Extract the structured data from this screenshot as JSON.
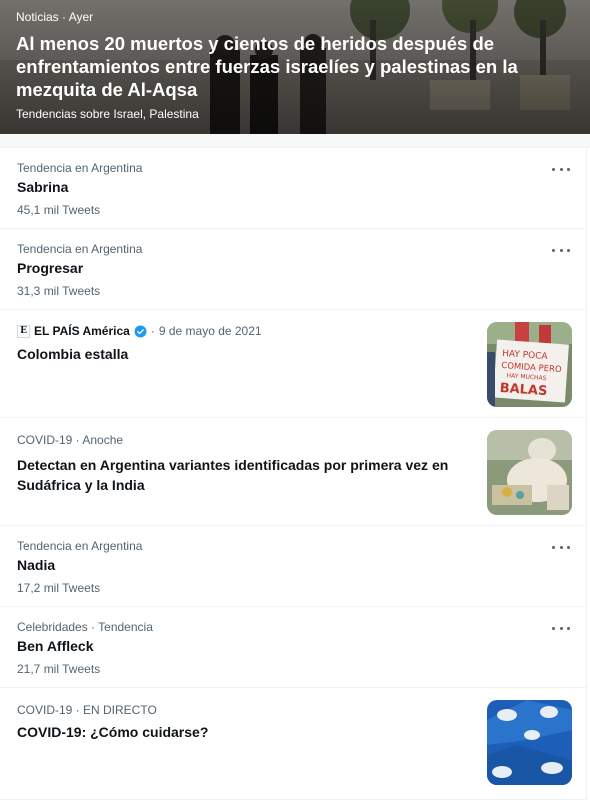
{
  "hero": {
    "category": "Noticias",
    "time": "Ayer",
    "headline": "Al menos 20 muertos y cientos de heridos después de enfrentamientos entre fuerzas israelíes y palestinas en la mezquita de Al-Aqsa",
    "topics_prefix": "Tendencias sobre",
    "topics": "Israel, Palestina"
  },
  "items": [
    {
      "context": "Tendencia en Argentina",
      "title": "Sabrina",
      "count": "45,1 mil Tweets"
    },
    {
      "context": "Tendencia en Argentina",
      "title": "Progresar",
      "count": "31,3 mil Tweets"
    },
    {
      "publisher": "EL PAÍS América",
      "publisher_logo": "E",
      "date": "9 de mayo de 2021",
      "title": "Colombia estalla",
      "thumb_text": [
        "HAY POCA",
        "COMIDA PERO",
        "HAY MUCHAS",
        "BALAS"
      ]
    },
    {
      "context": "COVID-19 · Anoche",
      "title": "Detectan en Argentina variantes identificadas por primera vez en Sudáfrica y la India"
    },
    {
      "context": "Tendencia en Argentina",
      "title": "Nadia",
      "count": "17,2 mil Tweets"
    },
    {
      "context": "Celebridades · Tendencia",
      "title": "Ben Affleck",
      "count": "21,7 mil Tweets"
    },
    {
      "context": "COVID-19 · EN DIRECTO",
      "title": "COVID-19: ¿Cómo cuidarse?"
    }
  ],
  "colors": {
    "secondary_text": "#536471",
    "verified": "#1d9bf0",
    "divider": "#eff3f4"
  }
}
